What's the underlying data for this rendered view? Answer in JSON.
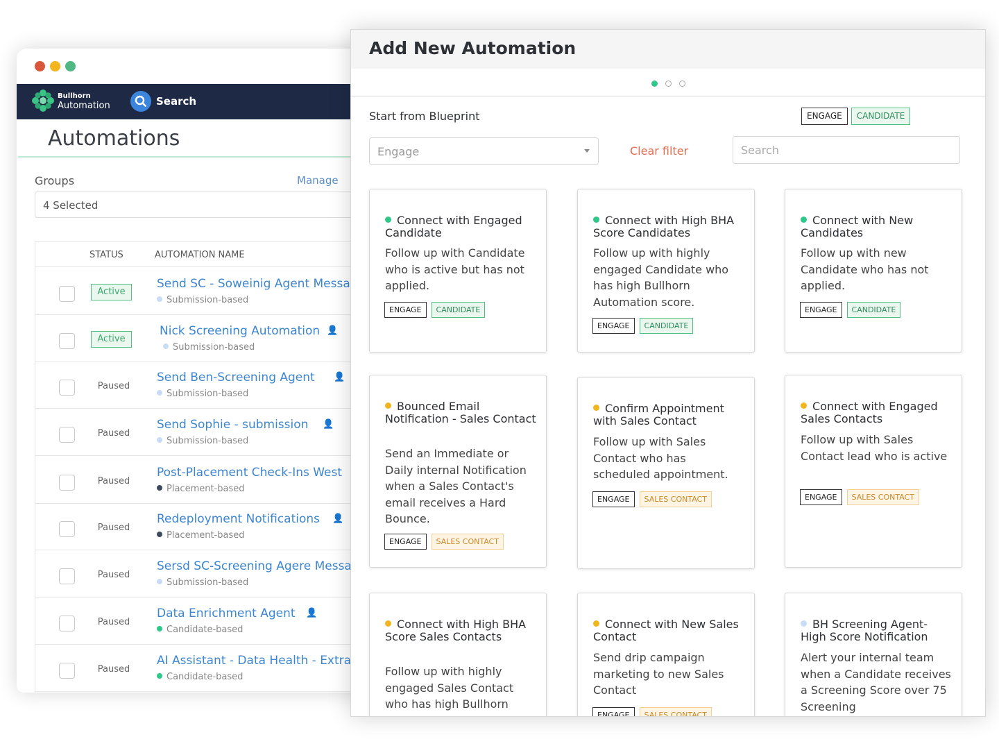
{
  "colors": {
    "active": "#2ec88a",
    "amber": "#f2b51d",
    "light": "#c9dcf5",
    "link": "#3c86d0",
    "clear": "#e46c4f"
  },
  "back_window": {
    "brand_line1": "Bullhorn",
    "brand_line2": "Automation",
    "search_label": "Search",
    "title": "Automations",
    "groups_label": "Groups",
    "manage_label": "Manage",
    "groups_value": "4 Selected",
    "columns": [
      "STATUS",
      "AUTOMATION NAME"
    ],
    "rows": [
      {
        "status": "Active",
        "name": "Send SC - Soweinig Agent Messa",
        "type": "Submission-based",
        "dot": "#c9dcf5",
        "icon": ""
      },
      {
        "status": "Active",
        "name": "Nick Screening Automation",
        "type": "Submission-based",
        "dot": "#c9dcf5",
        "icon": "agent-icon"
      },
      {
        "status": "Paused",
        "name": "Send Ben-Screening Agent",
        "type": "Submission-based",
        "dot": "#c9dcf5",
        "icon": "agent-icon"
      },
      {
        "status": "Paused",
        "name": "Send Sophie - submission",
        "type": "Submission-based",
        "dot": "#c9dcf5",
        "icon": "agent-icon"
      },
      {
        "status": "Paused",
        "name": "Post-Placement Check-Ins West",
        "type": "Placement-based",
        "dot": "#3c4a5e",
        "icon": ""
      },
      {
        "status": "Paused",
        "name": "Redeployment Notifications",
        "type": "Placement-based",
        "dot": "#3c4a5e",
        "icon": "agent-icon"
      },
      {
        "status": "Paused",
        "name": "Sersd SC-Screening Agere Messa",
        "type": "Submission-based",
        "dot": "#c9dcf5",
        "icon": ""
      },
      {
        "status": "Paused",
        "name": "Data Enrichment Agent",
        "type": "Candidate-based",
        "dot": "#2ec88a",
        "icon": "agent-icon"
      },
      {
        "status": "Paused",
        "name": "AI Assistant - Data Health - Extra",
        "type": "Candidate-based",
        "dot": "#2ec88a",
        "icon": ""
      }
    ]
  },
  "modal": {
    "title": "Add New Automation",
    "blueprint_label": "Start from Blueprint",
    "top_tags": [
      "ENGAGE",
      "CANDIDATE"
    ],
    "filter_value": "Engage",
    "clear_filter": "Clear filter",
    "search_placeholder": "Search",
    "cards": [
      {
        "title": "Connect with Engaged Candidate",
        "desc": "Follow up with Candidate who is active but has not applied.",
        "dot": "#2ec88a",
        "tags": [
          "ENGAGE",
          "CANDIDATE"
        ]
      },
      {
        "title": "Connect with High BHA Score Candidates",
        "desc": "Follow up with highly engaged Candidate who has high Bullhorn Automation score.",
        "dot": "#2ec88a",
        "tags": [
          "ENGAGE",
          "CANDIDATE"
        ]
      },
      {
        "title": "Connect with New Candidates",
        "desc": "Follow up with new Candidate who has not applied.",
        "dot": "#2ec88a",
        "tags": [
          "ENGAGE",
          "CANDIDATE"
        ]
      },
      {
        "title": "Bounced Email Notification - Sales Contact",
        "desc": "Send an Immediate or Daily internal Notification when a Sales Contact's email receives a Hard Bounce.",
        "dot": "#f2b51d",
        "tags": [
          "ENGAGE",
          "SALES CONTACT"
        ]
      },
      {
        "title": "Confirm Appointment with Sales Contact",
        "desc": "Follow up with Sales Contact who has scheduled appointment.",
        "dot": "#f2b51d",
        "tags": [
          "ENGAGE",
          "SALES CONTACT"
        ]
      },
      {
        "title": "Connect with Engaged Sales Contacts",
        "desc": "Follow up with Sales Contact lead who is active",
        "dot": "#f2b51d",
        "tags": [
          "ENGAGE",
          "SALES CONTACT"
        ]
      },
      {
        "title": "Connect with High BHA Score Sales Contacts",
        "desc": "Follow up with highly engaged Sales Contact who has high Bullhorn",
        "dot": "#f2b51d",
        "tags": []
      },
      {
        "title": "Connect with New Sales Contact",
        "desc": "Send drip campaign marketing to new Sales Contact",
        "dot": "#f2b51d",
        "tags": [
          "ENGAGE",
          "SALES CONTACT"
        ]
      },
      {
        "title": "BH Screening Agent- High Score Notification",
        "desc": "Alert your internal team when a Candidate receives a Screening Score over 75 Screening",
        "dot": "#c9dcf5",
        "tags": []
      }
    ]
  }
}
